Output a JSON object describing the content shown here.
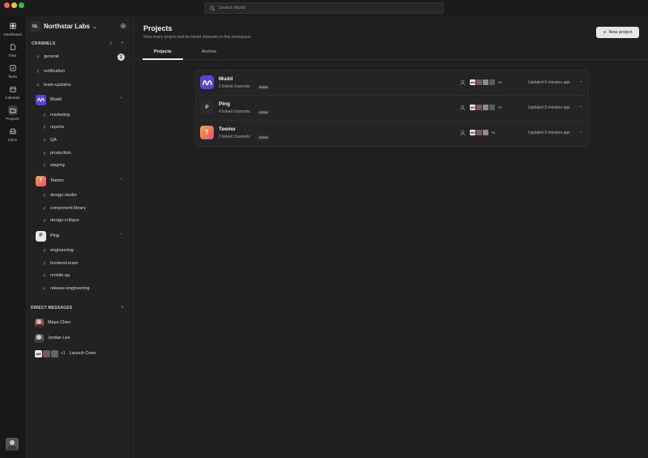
{
  "search": {
    "placeholder": "Search Mudd"
  },
  "rail": {
    "items": [
      {
        "label": "Dashboard",
        "icon": "dashboard-icon"
      },
      {
        "label": "Files",
        "icon": "file-icon"
      },
      {
        "label": "Tasks",
        "icon": "tasks-icon"
      },
      {
        "label": "Calendar",
        "icon": "calendar-icon"
      },
      {
        "label": "Projects",
        "icon": "folder-icon"
      },
      {
        "label": "Inbox",
        "icon": "inbox-icon"
      }
    ]
  },
  "workspace": {
    "badge": "NL",
    "name": "Northstar Labs"
  },
  "sidebar": {
    "channels_heading": "CHANNELS",
    "channels": [
      {
        "name": "general",
        "badge": "2"
      },
      {
        "name": "notification"
      },
      {
        "name": "team-updates"
      }
    ],
    "projects": [
      {
        "name": "Mudd",
        "color": "#5b3fe0",
        "channels": [
          "marketing",
          "reports",
          "QA",
          "production",
          "staging"
        ]
      },
      {
        "name": "Teemo",
        "color": "#f0664f",
        "letter": "T",
        "channels": [
          "design-studio",
          "component-library",
          "design-critique"
        ]
      },
      {
        "name": "Ping",
        "color": "#e8e8e8",
        "letter": "P",
        "channels": [
          "engineering",
          "frontend-team",
          "mobile-qa",
          "release-engineering"
        ]
      }
    ],
    "dm_heading": "DIRECT MESSAGES",
    "dms": [
      {
        "name": "Maya Chen"
      },
      {
        "name": "Jordan Lee"
      },
      {
        "name": "Launch Crew",
        "initials": "AM",
        "more": "+1"
      }
    ]
  },
  "main": {
    "title": "Projects",
    "subtitle": "View every project and its linked channels in this workspace.",
    "new_project_label": "New project",
    "tabs": [
      {
        "label": "Projects"
      },
      {
        "label": "Archive"
      }
    ],
    "rows": [
      {
        "name": "Mudd",
        "meta": "5 linked channels",
        "status": "Active",
        "initials": "AM",
        "more": "+3",
        "updated": "Updated 9 minutes ago",
        "color": "#5b3fe0"
      },
      {
        "name": "Ping",
        "meta": "4 linked channels",
        "status": "Active",
        "initials": "AM",
        "more": "+2",
        "updated": "Updated 9 minutes ago",
        "color": "#2a2a2a",
        "letter": "P"
      },
      {
        "name": "Teemo",
        "meta": "3 linked channels",
        "status": "Active",
        "initials": "AM",
        "more": "+1",
        "updated": "Updated 9 minutes ago",
        "color": "#f0664f",
        "letter": "T"
      }
    ]
  }
}
